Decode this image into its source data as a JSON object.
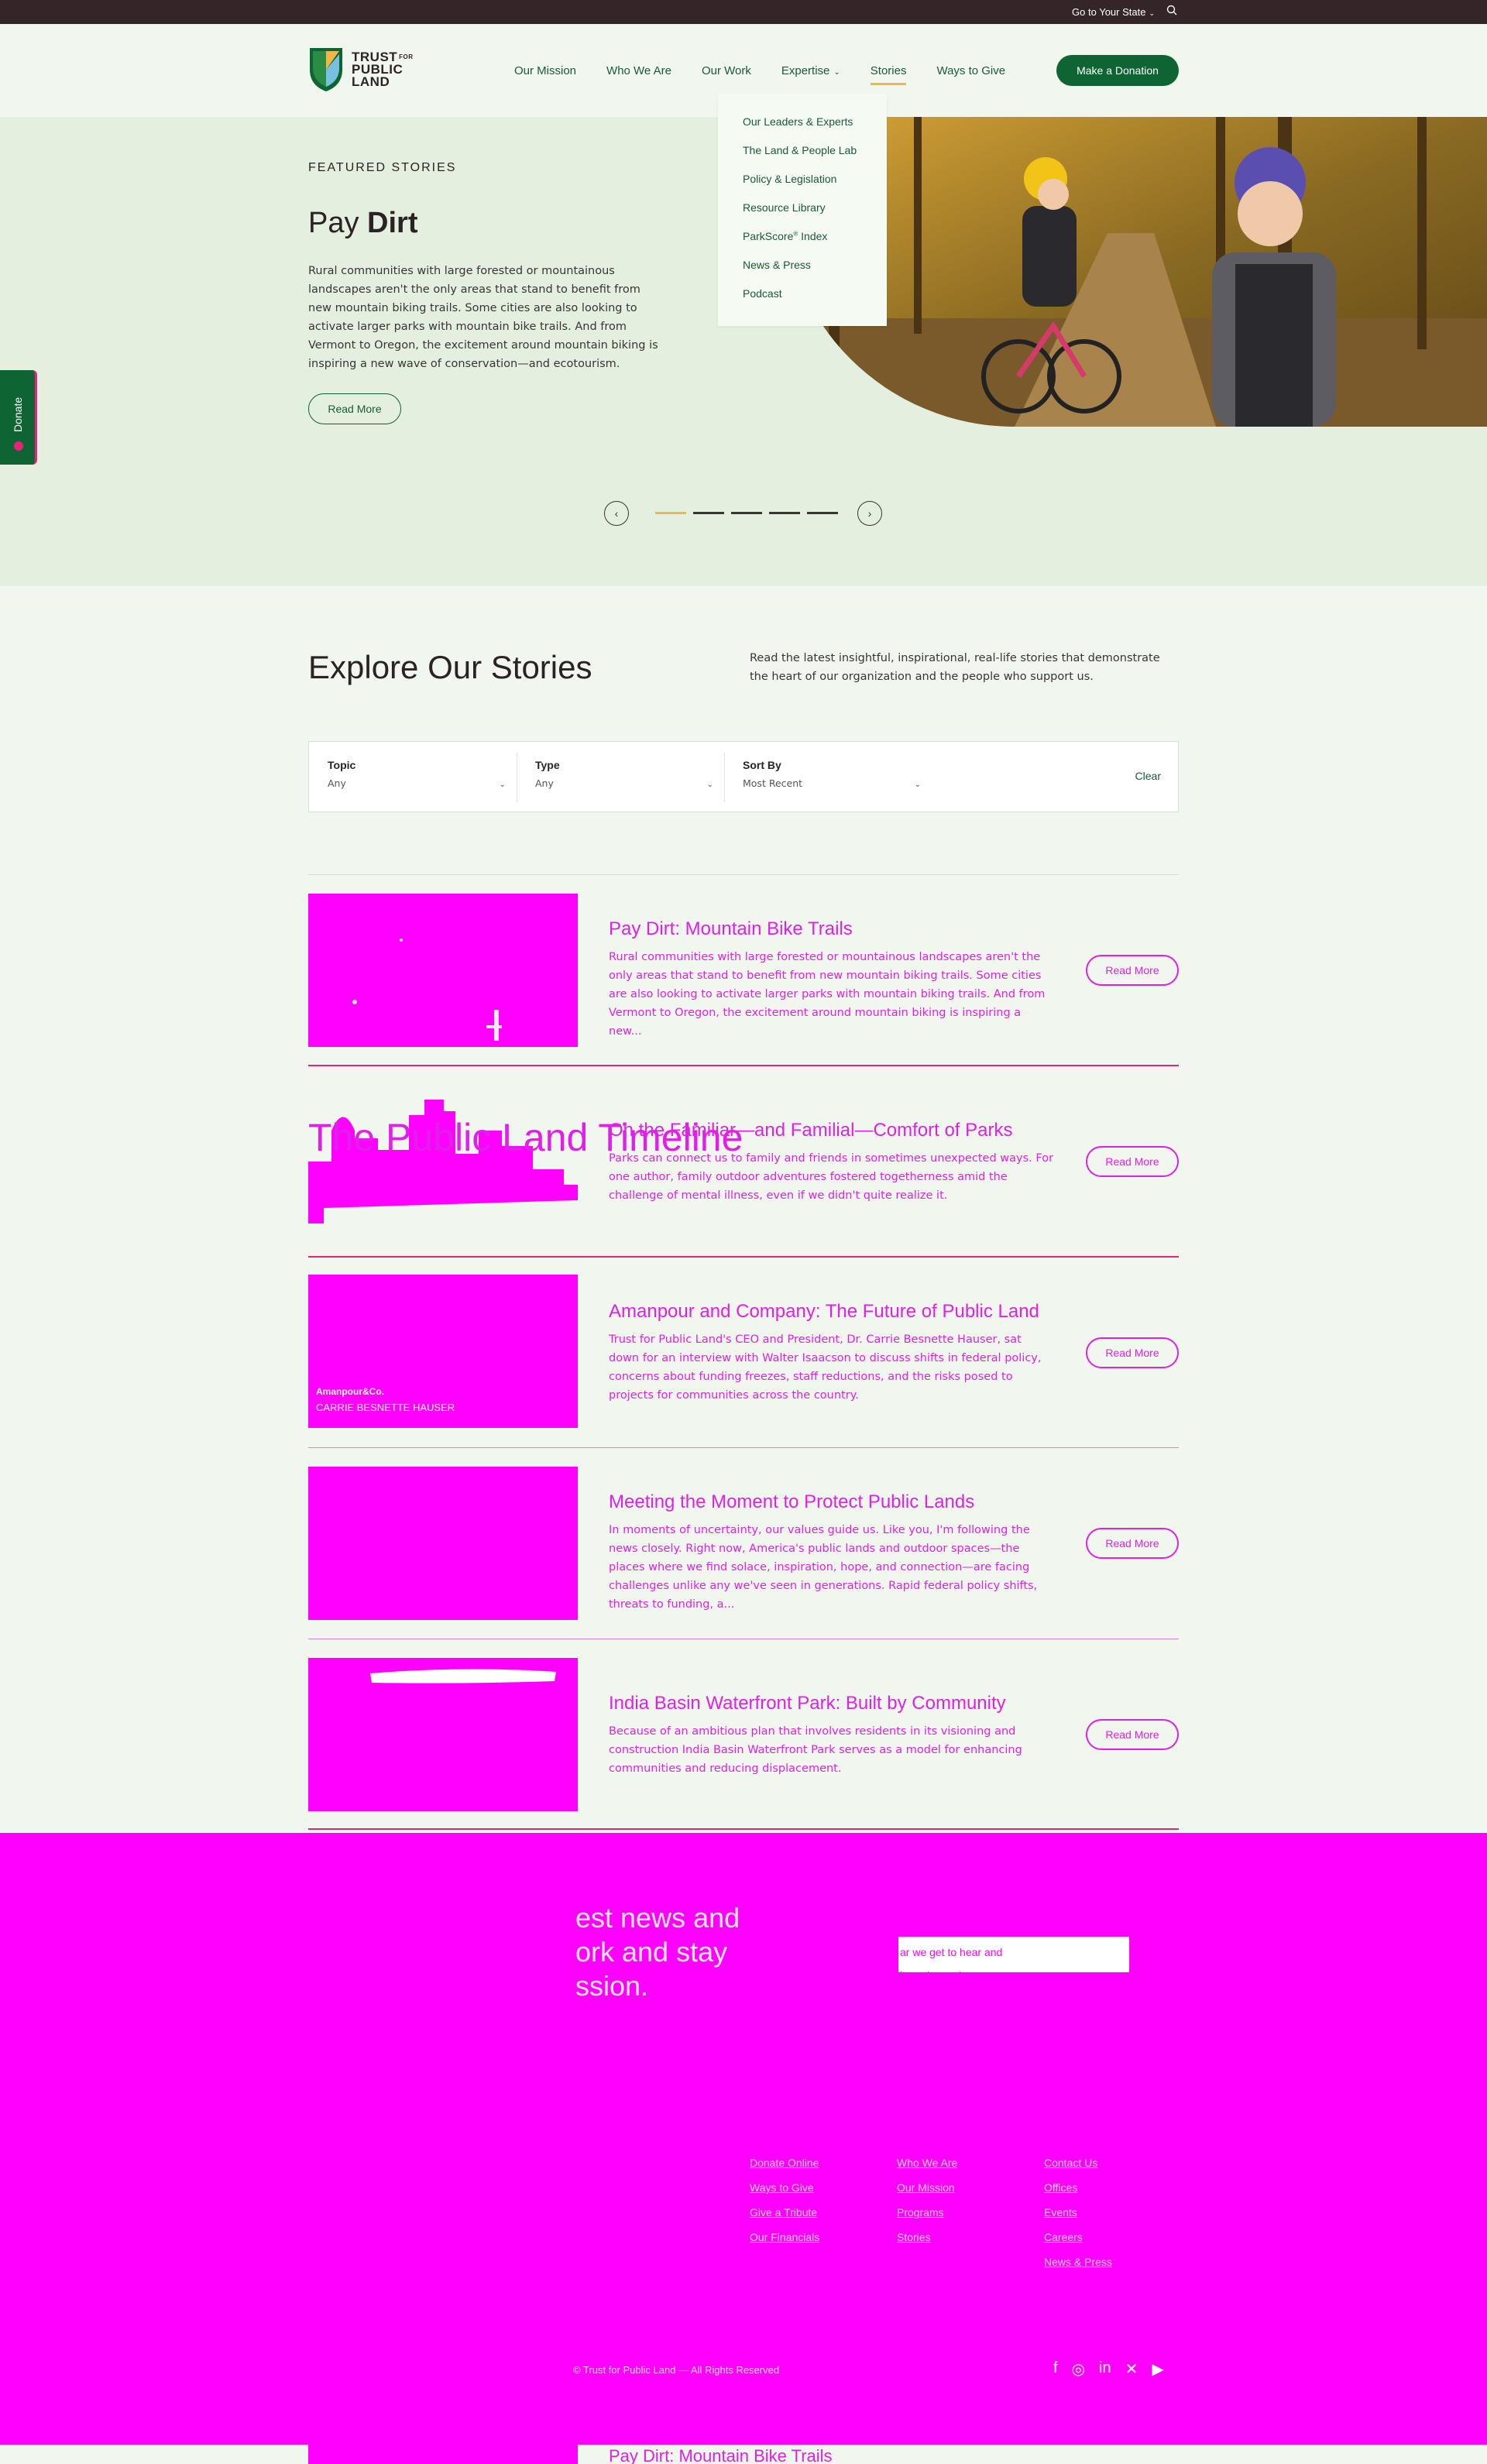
{
  "topbar": {
    "state_label": "Go to Your State"
  },
  "logo": {
    "line1": "TRUST",
    "for": "FOR",
    "line2": "PUBLIC",
    "line3": "LAND"
  },
  "nav": {
    "items": [
      {
        "label": "Our Mission"
      },
      {
        "label": "Who We Are"
      },
      {
        "label": "Our Work"
      },
      {
        "label": "Expertise"
      },
      {
        "label": "Stories"
      },
      {
        "label": "Ways to Give"
      }
    ],
    "donate_label": "Make a Donation"
  },
  "dropdown": {
    "items": [
      "Our Leaders & Experts",
      "The Land & People Lab",
      "Policy & Legislation",
      "Resource Library",
      "ParkScore",
      "News & Press",
      "Podcast"
    ],
    "parkscore_suffix": " Index",
    "parkscore_mark": "®"
  },
  "hero": {
    "eyebrow": "FEATURED STORIES",
    "title_light": "Pay ",
    "title_bold": "Dirt",
    "text": "Rural communities with large forested or mountainous landscapes aren't the only areas that stand to benefit from new mountain biking trails. Some cities are also looking to activate larger parks with mountain bike trails. And from Vermont to Oregon, the excitement around mountain biking is inspiring a new wave of conservation—and ecotourism.",
    "read_more": "Read More",
    "slide_progress": "1 of 5"
  },
  "donate_tab": {
    "label": "Donate"
  },
  "explore": {
    "title": "Explore Our Stories",
    "text": "Read the latest insightful, inspirational, real-life stories that demonstrate the heart of our organization and the people who support us."
  },
  "filters": {
    "topic": {
      "label": "Topic",
      "value": "Any"
    },
    "type": {
      "label": "Type",
      "value": "Any"
    },
    "sort": {
      "label": "Sort By",
      "value": "Most Recent"
    },
    "clear": "Clear"
  },
  "stories": [
    {
      "title": "Pay Dirt: Mountain Bike Trails",
      "text": "Rural communities with large forested or mountainous landscapes aren't the only areas that stand to benefit from new mountain biking trails. Some cities are also looking to activate larger parks with mountain biking trails. And from Vermont to Oregon, the excitement around mountain biking is inspiring a new...",
      "read_more": "Read More"
    },
    {
      "title": "On the Familiar—and Familial—Comfort of Parks",
      "text": "Parks can connect us to family and friends in sometimes unexpected ways. For one author, family outdoor adventures fostered togetherness amid the challenge of mental illness, even if we didn't quite realize it.",
      "read_more": "Read More",
      "image_text": "The Public Land Timeline"
    },
    {
      "title": "Amanpour and Company: The Future of Public Land",
      "text": "Trust for Public Land's CEO and President, Dr. Carrie Besnette Hauser, sat down for an interview with Walter Isaacson to discuss shifts in federal policy, concerns about funding freezes, staff reductions, and the risks posed to projects for communities across the country.",
      "read_more": "Read More",
      "image_caption_1": "Amanpour&Co.",
      "image_caption_2": "CARRIE BESNETTE HAUSER"
    },
    {
      "title": "Meeting the Moment to Protect Public Lands",
      "text": "In moments of uncertainty, our values guide us. Like you, I'm following the news closely. Right now, America's public lands and outdoor spaces—the places where we find solace, inspiration, hope, and connection—are facing challenges unlike any we've seen in generations. Rapid federal policy shifts, threats to funding, a...",
      "read_more": "Read More"
    },
    {
      "title": "India Basin Waterfront Park: Built by Community",
      "text": "Because of an ambitious plan that involves residents in its visioning and construction India Basin Waterfront Park serves as a model for enhancing communities and reducing displacement.",
      "read_more": "Read More"
    }
  ],
  "footer": {
    "newsletter_title": "est news and\nork and stay\nssion.",
    "box_text": "ar we get to hear and\nle and growth",
    "col1": [
      "Donate Online",
      "Ways to Give",
      "Give a Tribute",
      "Our Financials"
    ],
    "col2": [
      "Who We Are",
      "Our Mission",
      "Programs",
      "Stories"
    ],
    "col3": [
      "Contact Us",
      "Offices",
      "Events",
      "Careers",
      "News & Press"
    ],
    "copyright": "© Trust for Public Land — All Rights Reserved"
  },
  "next_story": {
    "title": "Pay Dirt: Mountain Bike Trails"
  },
  "colors": {
    "brand_green": "#0e6432",
    "accent_gold": "#f2b642",
    "hero_bg": "#e3f0df",
    "page_bg": "#f1f7ef",
    "magenta": "#ff00ff"
  }
}
